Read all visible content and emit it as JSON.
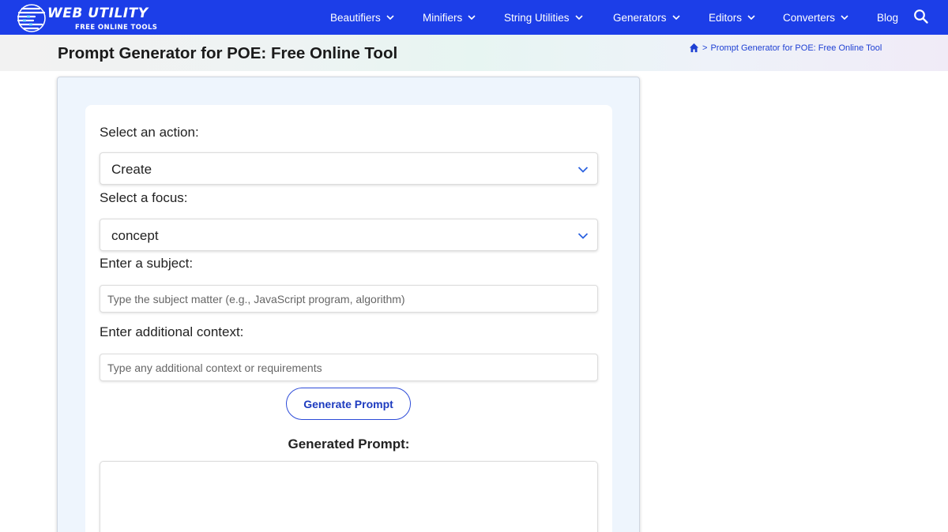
{
  "brand": {
    "name": "WEB UTILITY",
    "tagline": "FREE ONLINE TOOLS"
  },
  "nav": {
    "items": [
      {
        "label": "Beautifiers"
      },
      {
        "label": "Minifiers"
      },
      {
        "label": "String Utilities"
      },
      {
        "label": "Generators"
      },
      {
        "label": "Editors"
      },
      {
        "label": "Converters"
      },
      {
        "label": "Blog"
      }
    ],
    "search_icon": "search-icon"
  },
  "header": {
    "title": "Prompt Generator for POE: Free Online Tool",
    "breadcrumb": {
      "home_icon": "home-icon",
      "separator": ">",
      "current": "Prompt Generator for POE: Free Online Tool"
    }
  },
  "form": {
    "action_label": "Select an action:",
    "action_value": "Create",
    "focus_label": "Select a focus:",
    "focus_value": "concept",
    "subject_label": "Enter a subject:",
    "subject_placeholder": "Type the subject matter (e.g., JavaScript program, algorithm)",
    "subject_value": "",
    "context_label": "Enter additional context:",
    "context_placeholder": "Type any additional context or requirements",
    "context_value": "",
    "generate_button": "Generate Prompt",
    "output_heading": "Generated Prompt:",
    "output_value": ""
  },
  "colors": {
    "nav_bg": "#1c3ee8",
    "accent": "#2c4bd8",
    "panel_bg": "#eef5fd"
  }
}
